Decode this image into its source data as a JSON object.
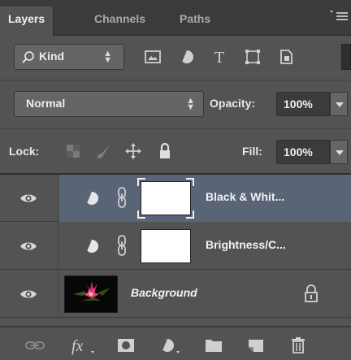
{
  "tabs": {
    "layers": "Layers",
    "channels": "Channels",
    "paths": "Paths"
  },
  "filter": {
    "kind_label": "Kind",
    "kind_arrows": "⬍"
  },
  "blend": {
    "mode": "Normal",
    "opacity_label": "Opacity:",
    "opacity_value": "100%"
  },
  "lock": {
    "label": "Lock:",
    "fill_label": "Fill:",
    "fill_value": "100%"
  },
  "layers": [
    {
      "name": "Black & Whit...",
      "type": "adjustment",
      "selected": true
    },
    {
      "name": "Brightness/C...",
      "type": "adjustment",
      "selected": false
    },
    {
      "name": "Background",
      "type": "image",
      "selected": false
    }
  ],
  "colors": {
    "panel": "#535353",
    "selection": "#596476",
    "dark": "#3b3b3b"
  }
}
